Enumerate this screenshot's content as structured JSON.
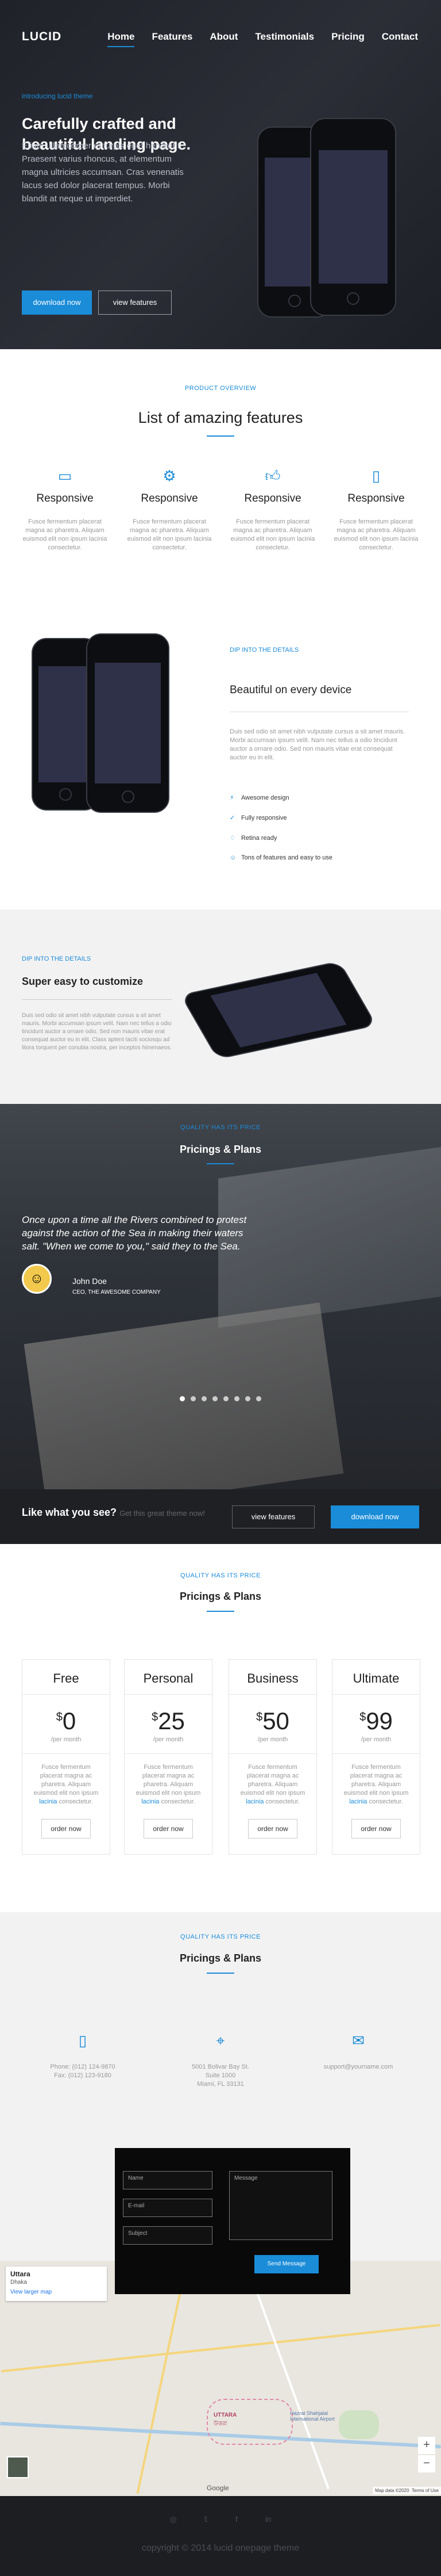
{
  "nav": {
    "logo": "LUCID",
    "items": [
      "Home",
      "Features",
      "About",
      "Testimonials",
      "Pricing",
      "Contact"
    ]
  },
  "hero": {
    "kicker": "introducing lucid theme",
    "title": "Carefully crafted and beautiful landing page.",
    "text": "Etiam ullamcorper et turpis eget hendrerit. Praesent varius rhoncus, at elementum magna ultricies accumsan. Cras venenatis lacus sed dolor placerat tempus. Morbi blandit at neque ut imperdiet.",
    "btn_download": "download now",
    "btn_features": "view features"
  },
  "overview": {
    "kicker": "PRODUCT OVERVIEW",
    "title": "List of amazing features",
    "items": [
      {
        "icon": "monitor-icon",
        "title": "Responsive",
        "text": "Fusce fermentum placerat magna ac pharetra. Aliquam euismod elit non ipsum lacinia consectetur."
      },
      {
        "icon": "gear-icon",
        "title": "Responsive",
        "text": "Fusce fermentum placerat magna ac pharetra. Aliquam euismod elit non ipsum lacinia consectetur."
      },
      {
        "icon": "thumbs-up-icon",
        "title": "Responsive",
        "text": "Fusce fermentum placerat magna ac pharetra. Aliquam euismod elit non ipsum lacinia consectetur."
      },
      {
        "icon": "mobile-icon",
        "title": "Responsive",
        "text": "Fusce fermentum placerat magna ac pharetra. Aliquam euismod elit non ipsum lacinia consectetur."
      }
    ]
  },
  "details": {
    "kicker": "DIP INTO THE DETAILS",
    "title": "Beautiful on every device",
    "text": "Duis sed odio sit amet nibh vulputate cursus a sit amet mauris. Morbi accumsan ipsum velit. Nam nec tellus a odio tincidunt auctor a ornare odio. Sed non mauris vitae erat consequat auctor eu in elit.",
    "list": [
      "Awesome design",
      "Fully responsive",
      "Retina ready",
      "Tons of features and easy to use"
    ]
  },
  "easy": {
    "kicker": "DIP INTO THE DETAILS",
    "title": "Super easy to customize",
    "text": "Duis sed odio sit amet nibh vulputate cursus a sit amet mauris. Morbi accumsan ipsum velit. Nam nec tellus a odio tincidunt auctor a ornare odio. Sed non mauris vitae erat consequat auctor eu in elit. Class aptent taciti sociosqu ad litora torquent per conubia nostra, per inceptos himenaeos."
  },
  "testimonial": {
    "kicker": "QUALITY HAS ITS PRICE",
    "title": "Pricings & Plans",
    "quote": "Once upon a time all the Rivers combined to protest against the action of the Sea in making their waters salt. \"When we come to you,\" said they to the Sea.",
    "name": "John Doe",
    "role": "CEO, THE AWESOME COMPANY"
  },
  "cta": {
    "title": "Like what you see?",
    "sub": "Get this great theme now!",
    "btn_features": "view features",
    "btn_download": "download now"
  },
  "plans": {
    "kicker": "QUALITY HAS ITS PRICE",
    "title": "Pricings & Plans",
    "items": [
      {
        "name": "Free",
        "price": "0",
        "per": "/per month",
        "text": "Fusce fermentum placerat magna ac pharetra. Aliquam euismod elit non ipsum",
        "link": "lacinia",
        "text2": "consectetur.",
        "btn": "order now"
      },
      {
        "name": "Personal",
        "price": "25",
        "per": "/per month",
        "text": "Fusce fermentum placerat magna ac pharetra. Aliquam euismod elit non ipsum",
        "link": "lacinia",
        "text2": "consectetur.",
        "btn": "order now"
      },
      {
        "name": "Business",
        "price": "50",
        "per": "/per month",
        "text": "Fusce fermentum placerat magna ac pharetra. Aliquam euismod elit non ipsum",
        "link": "lacinia",
        "text2": "consectetur.",
        "btn": "order now"
      },
      {
        "name": "Ultimate",
        "price": "99",
        "per": "/per month",
        "text": "Fusce fermentum placerat magna ac pharetra. Aliquam euismod elit non ipsum",
        "link": "lacinia",
        "text2": "consectetur.",
        "btn": "order now"
      }
    ]
  },
  "contact": {
    "kicker": "QUALITY HAS ITS PRICE",
    "title": "Pricings & Plans",
    "phone": "Phone: (012) 124-9870",
    "fax": "Fax: (012) 123-9180",
    "addr1": "5001 Bolivar Bay St.",
    "addr2": "Suite 1000",
    "addr3": "Miami, FL 33131",
    "email": "support@yourname.com",
    "form": {
      "name": "Name",
      "email": "E-mail",
      "subject": "Subject",
      "message": "Message",
      "send": "Send Message"
    }
  },
  "map": {
    "place": "Uttara",
    "sub": "Dhaka",
    "link": "View larger map",
    "label1": "UTTARA",
    "label2": "উত্তরা",
    "label3": "Hazrat Shahjalal International Airport",
    "google": "Google",
    "mapdata": "Map data ©2020",
    "terms": "Terms of Use"
  },
  "footer": {
    "copy": "copyright © 2014 lucid onepage theme"
  }
}
